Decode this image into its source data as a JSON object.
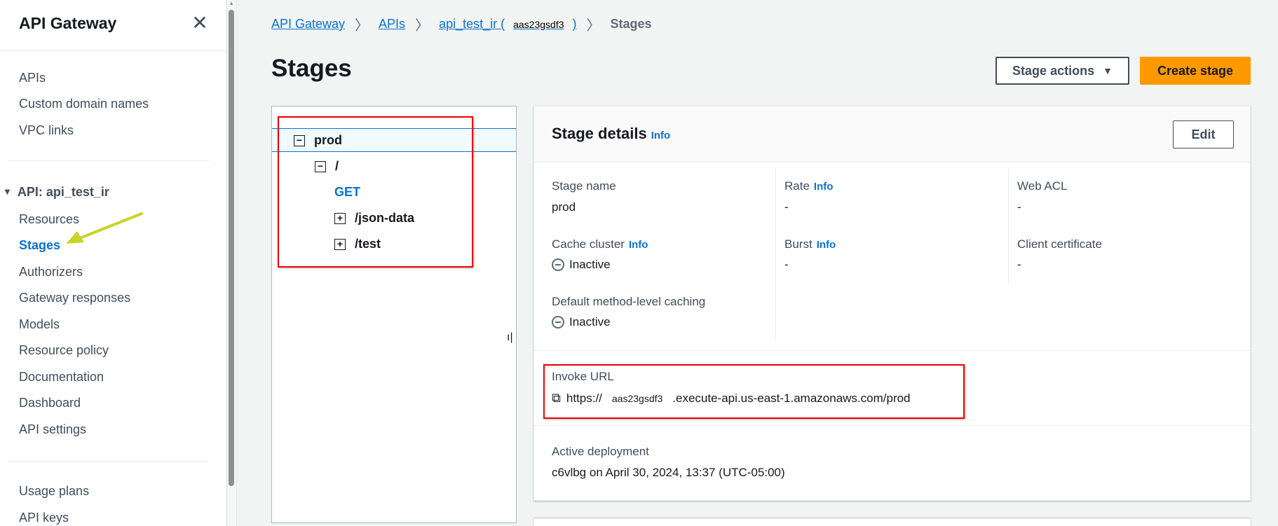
{
  "sidebar": {
    "title": "API Gateway",
    "close_icon": "close-icon",
    "top_items": [
      "APIs",
      "Custom domain names",
      "VPC links"
    ],
    "section_title": "API: api_test_ir",
    "api_items": [
      "Resources",
      "Stages",
      "Authorizers",
      "Gateway responses",
      "Models",
      "Resource policy",
      "Documentation",
      "Dashboard",
      "API settings"
    ],
    "active_item": "Stages",
    "bottom_items": [
      "Usage plans",
      "API keys"
    ]
  },
  "breadcrumb": {
    "items": [
      "API Gateway",
      "APIs"
    ],
    "api_name_prefix": "api_test_ir (",
    "api_id": "aas23gsdf3",
    "api_name_suffix": ")",
    "current": "Stages"
  },
  "page": {
    "title": "Stages",
    "stage_actions_label": "Stage actions",
    "create_stage_label": "Create stage"
  },
  "tree": {
    "stage": "prod",
    "root": "/",
    "method": "GET",
    "children": [
      "/json-data",
      "/test"
    ]
  },
  "details": {
    "title": "Stage details",
    "info": "Info",
    "edit_label": "Edit",
    "stage_name_label": "Stage name",
    "stage_name_value": "prod",
    "rate_label": "Rate",
    "rate_value": "-",
    "web_acl_label": "Web ACL",
    "web_acl_value": "-",
    "cache_cluster_label": "Cache cluster",
    "cache_cluster_value": "Inactive",
    "burst_label": "Burst",
    "burst_value": "-",
    "client_cert_label": "Client certificate",
    "client_cert_value": "-",
    "method_caching_label": "Default method-level caching",
    "method_caching_value": "Inactive",
    "invoke_url_label": "Invoke URL",
    "invoke_url_prefix": "https://",
    "invoke_url_id": "aas23gsdf3",
    "invoke_url_suffix": ".execute-api.us-east-1.amazonaws.com/prod",
    "active_deployment_label": "Active deployment",
    "active_deployment_value": "c6vlbg on April 30, 2024, 13:37 (UTC-05:00)"
  },
  "colors": {
    "accent": "#0972d3",
    "primary_button": "#ff9900",
    "highlight_box": "#ee0000",
    "annotation_arrow": "#c8d42a"
  }
}
